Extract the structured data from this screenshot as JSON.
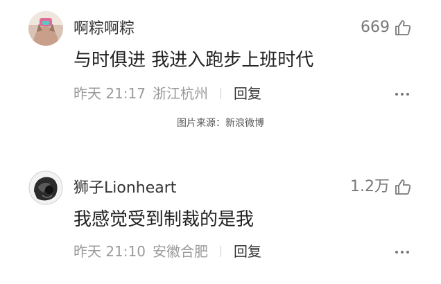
{
  "comments": [
    {
      "username": "啊粽啊粽",
      "likes": "669",
      "text": "与时俱进 我进入跑步上班时代",
      "time": "昨天 21:17",
      "location": "浙江杭州",
      "reply_label": "回复"
    },
    {
      "username": "狮子Lionheart",
      "likes": "1.2万",
      "text": "我感觉受到制裁的是我",
      "time": "昨天 21:10",
      "location": "安徽合肥",
      "reply_label": "回复"
    }
  ],
  "image_source": "图片来源：新浪微博",
  "icons": {
    "like": "thumbs-up-icon",
    "more": "more-dots-icon"
  },
  "colors": {
    "text": "#222222",
    "meta": "#999999",
    "likes": "#777777"
  }
}
